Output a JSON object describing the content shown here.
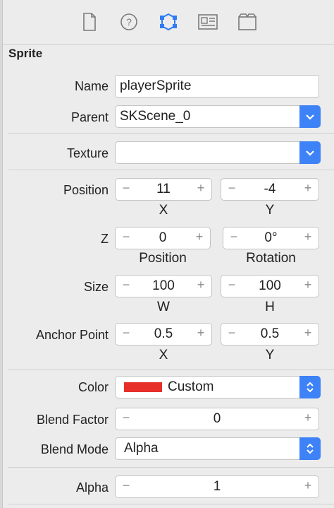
{
  "section_title": "Sprite",
  "name": {
    "label": "Name",
    "value": "playerSprite"
  },
  "parent": {
    "label": "Parent",
    "value": "SKScene_0"
  },
  "texture": {
    "label": "Texture",
    "value": ""
  },
  "position": {
    "label": "Position",
    "x": "11",
    "y": "-4",
    "x_label": "X",
    "y_label": "Y"
  },
  "z": {
    "label": "Z",
    "position": "0",
    "rotation": "0°",
    "position_label": "Position",
    "rotation_label": "Rotation"
  },
  "size": {
    "label": "Size",
    "w": "100",
    "h": "100",
    "w_label": "W",
    "h_label": "H"
  },
  "anchor": {
    "label": "Anchor Point",
    "x": "0.5",
    "y": "0.5",
    "x_label": "X",
    "y_label": "Y"
  },
  "color": {
    "label": "Color",
    "value": "Custom",
    "swatch": "#e8302a"
  },
  "blend_factor": {
    "label": "Blend Factor",
    "value": "0"
  },
  "blend_mode": {
    "label": "Blend Mode",
    "value": "Alpha"
  },
  "alpha": {
    "label": "Alpha",
    "value": "1"
  },
  "stepper": {
    "minus": "−",
    "plus": "+"
  },
  "colors": {
    "accent": "#3d82f6",
    "inspector_icon_active": "#2f7cf6"
  },
  "toolbar_icons": [
    "file-inspector-icon",
    "help-inspector-icon",
    "attributes-inspector-icon",
    "media-inspector-icon",
    "library-icon"
  ]
}
